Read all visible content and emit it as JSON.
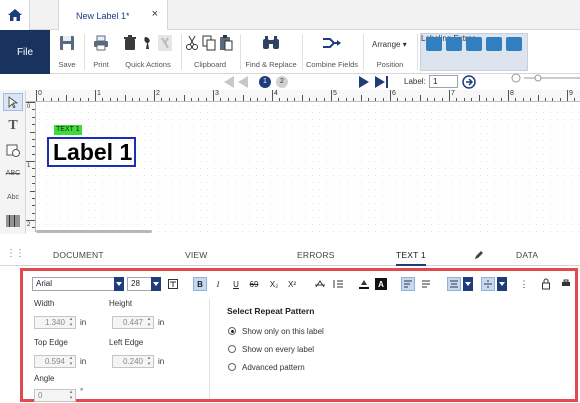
{
  "window": {
    "doc_tab_title": "New Label 1*",
    "close_glyph": "×"
  },
  "ribbon": {
    "file_label": "File",
    "save_label": "Save",
    "print_label": "Print",
    "quick_actions_label": "Quick Actions",
    "clipboard_label": "Clipboard",
    "find_replace_label": "Find & Replace",
    "combine_fields_label": "Combine Fields",
    "arrange_label": "Arrange",
    "position_label": "Position",
    "labeling_extras_label": "Labeling Extras"
  },
  "nav": {
    "page_1": "1",
    "page_2": "2",
    "label_caption": "Label:",
    "label_value": "1"
  },
  "ruler": {
    "h_ticks": [
      "0",
      "1",
      "2",
      "3",
      "4",
      "5",
      "6",
      "7",
      "8",
      "9"
    ],
    "v_ticks": [
      "0",
      "1",
      "2"
    ]
  },
  "canvas": {
    "text_badge": "TEXT 1",
    "label_text": "Label 1",
    "badge_color": "#3ddc3d",
    "selection_color": "#1b2fb5"
  },
  "bottom_tabs": [
    "DOCUMENT",
    "VIEW",
    "ERRORS",
    "TEXT 1",
    "DATA SOURCES"
  ],
  "format": {
    "font_name": "Arial",
    "font_size": "28",
    "bold": "B",
    "italic": "I",
    "underline": "U",
    "strike": "69",
    "subscript": "X₂",
    "superscript": "X²"
  },
  "properties": {
    "width_label": "Width",
    "width_value": "1.340",
    "width_unit": "in",
    "height_label": "Height",
    "height_value": "0.447",
    "height_unit": "in",
    "top_label": "Top Edge",
    "top_value": "0.594",
    "top_unit": "in",
    "left_label": "Left Edge",
    "left_value": "0.240",
    "left_unit": "in",
    "angle_label": "Angle",
    "angle_value": "0",
    "angle_unit": "°"
  },
  "repeat": {
    "title": "Select Repeat Pattern",
    "options": [
      "Show only on this label",
      "Show on every label",
      "Advanced pattern"
    ],
    "selected": 0
  },
  "colors": {
    "file_bg": "#17335e",
    "accent": "#1f3d7a",
    "highlight_border": "#e14b4f"
  }
}
